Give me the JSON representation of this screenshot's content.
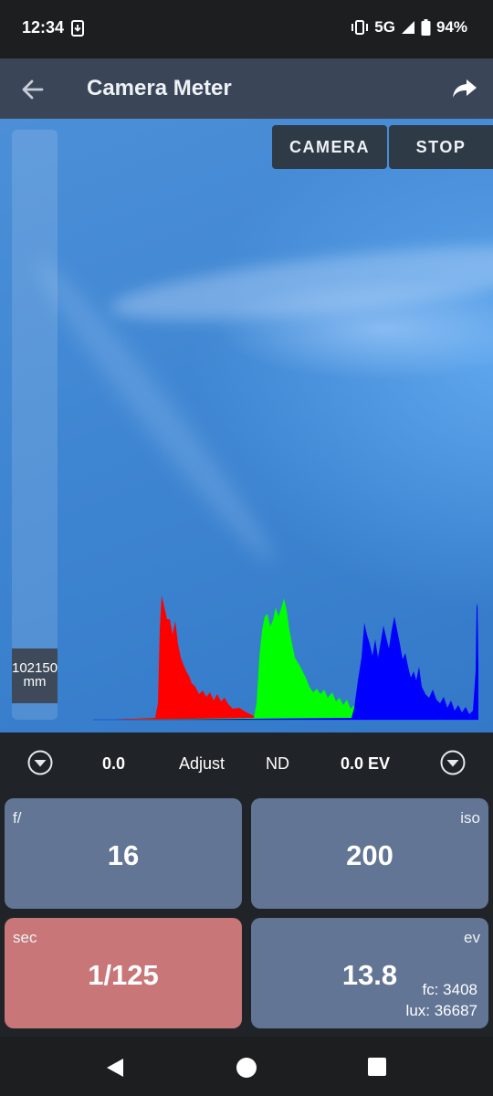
{
  "status_bar": {
    "time": "12:34",
    "network": "5G",
    "battery": "94%"
  },
  "app_bar": {
    "title": "Camera Meter"
  },
  "viewport": {
    "camera_button": "CAMERA",
    "stop_button": "STOP",
    "focus_value": "102150",
    "focus_unit": "mm",
    "histogram_colors": {
      "red": "#ff0000",
      "green": "#00ff00",
      "blue": "#0000ff"
    }
  },
  "adjust_row": {
    "left_value": "0.0",
    "adjust_label": "Adjust",
    "nd_label": "ND",
    "ev_value": "0.0 EV"
  },
  "cards": {
    "aperture": {
      "label": "f/",
      "value": "16"
    },
    "iso": {
      "label": "iso",
      "value": "200"
    },
    "shutter": {
      "label": "sec",
      "value": "1/125"
    },
    "ev": {
      "label": "ev",
      "value": "13.8",
      "fc": "fc: 3408",
      "lux": "lux: 36687"
    }
  },
  "colors": {
    "app_bar": "#3a4657",
    "card": "#627594",
    "shutter_card": "#c87678"
  }
}
